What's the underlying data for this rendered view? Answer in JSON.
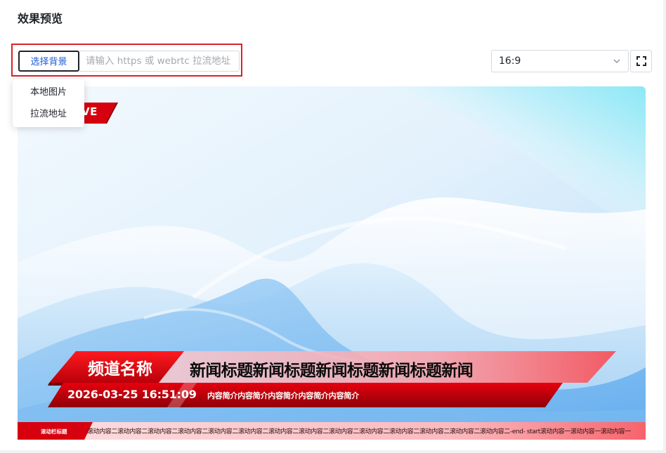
{
  "header": {
    "title": "效果预览"
  },
  "toolbar": {
    "select_background_label": "选择背景",
    "url_placeholder": "请输入 https 或 webrtc 拉流地址",
    "url_value": "",
    "ratio_value": "16:9"
  },
  "dropdown": {
    "items": [
      {
        "label": "本地图片"
      },
      {
        "label": "拉流地址"
      }
    ]
  },
  "preview": {
    "live_label": "VE",
    "channel_name": "频道名称",
    "headline": "新闻标题新闻标题新闻标题新闻标题新闻",
    "datetime": "2026-03-25 16:51:09",
    "summary": "内容简介内容简介内容简介内容简介内容简介",
    "ticker_title": "滚动栏标题",
    "ticker_content": "滚动内容二滚动内容二滚动内容二滚动内容二滚动内容二滚动内容二滚动内容二滚动内容二滚动内容二滚动内容二滚动内容二滚动内容二滚动内容二滚动内容二-end-      start滚动内容一滚动内容一滚动内容一"
  },
  "colors": {
    "accent_red": "#d9212c",
    "primary_blue": "#1c5bd9",
    "banner_red": "#d6000f"
  },
  "icons": {
    "ratio_chevron": "chevron-down-icon",
    "fullscreen": "fullscreen-icon"
  }
}
